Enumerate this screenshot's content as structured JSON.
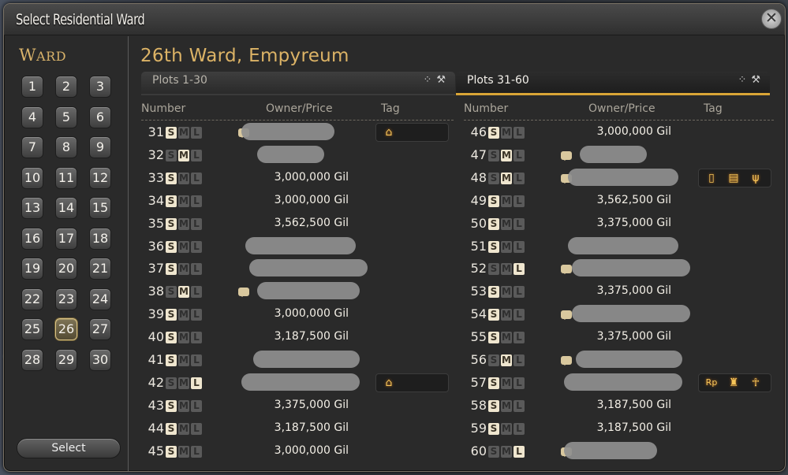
{
  "window": {
    "title": "Select Residential Ward",
    "close_symbol": "✕"
  },
  "ward_panel": {
    "label_first": "W",
    "label_rest": "ARD",
    "wards": [
      "1",
      "2",
      "3",
      "4",
      "5",
      "6",
      "7",
      "8",
      "9",
      "10",
      "11",
      "12",
      "13",
      "14",
      "15",
      "16",
      "17",
      "18",
      "19",
      "20",
      "21",
      "22",
      "23",
      "24",
      "25",
      "26",
      "27",
      "28",
      "29",
      "30"
    ],
    "selected": "26",
    "select_label": "Select"
  },
  "main": {
    "ward_title": "26th Ward, Empyreum",
    "tabs": [
      {
        "label": "Plots 1-30",
        "active": false,
        "icons": [
          "ownership-filter-icon",
          "auction-gavel-icon"
        ]
      },
      {
        "label": "Plots 31-60",
        "active": true,
        "icons": [
          "ownership-filter-icon",
          "auction-gavel-icon"
        ]
      }
    ],
    "columns": {
      "number": "Number",
      "owner_price": "Owner/Price",
      "tag": "Tag"
    },
    "left_rows": [
      {
        "number": "31",
        "size": "S",
        "price": "",
        "chat": true,
        "redacted": true,
        "tags": [
          "house-tag-icon"
        ]
      },
      {
        "number": "32",
        "size": "M",
        "price": "",
        "chat": false,
        "redacted": true,
        "tags": []
      },
      {
        "number": "33",
        "size": "S",
        "price": "3,000,000 Gil",
        "chat": false,
        "redacted": false,
        "tags": []
      },
      {
        "number": "34",
        "size": "S",
        "price": "3,000,000 Gil",
        "chat": false,
        "redacted": false,
        "tags": []
      },
      {
        "number": "35",
        "size": "S",
        "price": "3,562,500 Gil",
        "chat": false,
        "redacted": false,
        "tags": []
      },
      {
        "number": "36",
        "size": "S",
        "price": "",
        "chat": false,
        "redacted": true,
        "tags": []
      },
      {
        "number": "37",
        "size": "S",
        "price": "",
        "chat": false,
        "redacted": true,
        "tags": []
      },
      {
        "number": "38",
        "size": "M",
        "price": "",
        "chat": true,
        "redacted": true,
        "tags": []
      },
      {
        "number": "39",
        "size": "S",
        "price": "3,000,000 Gil",
        "chat": false,
        "redacted": false,
        "tags": []
      },
      {
        "number": "40",
        "size": "S",
        "price": "3,187,500 Gil",
        "chat": false,
        "redacted": false,
        "tags": []
      },
      {
        "number": "41",
        "size": "S",
        "price": "",
        "chat": false,
        "redacted": true,
        "tags": []
      },
      {
        "number": "42",
        "size": "L",
        "price": "",
        "chat": false,
        "redacted": true,
        "tags": [
          "house-tag-icon"
        ]
      },
      {
        "number": "43",
        "size": "S",
        "price": "3,375,000 Gil",
        "chat": false,
        "redacted": false,
        "tags": []
      },
      {
        "number": "44",
        "size": "S",
        "price": "3,187,500 Gil",
        "chat": false,
        "redacted": false,
        "tags": []
      },
      {
        "number": "45",
        "size": "S",
        "price": "3,000,000 Gil",
        "chat": false,
        "redacted": false,
        "tags": []
      }
    ],
    "right_rows": [
      {
        "number": "46",
        "size": "S",
        "price": "3,000,000 Gil",
        "chat": false,
        "redacted": false,
        "tags": []
      },
      {
        "number": "47",
        "size": "M",
        "price": "",
        "chat": true,
        "redacted": true,
        "tags": []
      },
      {
        "number": "48",
        "size": "M",
        "price": "",
        "chat": true,
        "redacted": true,
        "tags": [
          "door-tag-icon",
          "book-tag-icon",
          "dining-tag-icon"
        ]
      },
      {
        "number": "49",
        "size": "S",
        "price": "3,562,500 Gil",
        "chat": false,
        "redacted": false,
        "tags": []
      },
      {
        "number": "50",
        "size": "S",
        "price": "3,375,000 Gil",
        "chat": false,
        "redacted": false,
        "tags": []
      },
      {
        "number": "51",
        "size": "S",
        "price": "",
        "chat": false,
        "redacted": true,
        "tags": []
      },
      {
        "number": "52",
        "size": "L",
        "price": "",
        "chat": true,
        "redacted": true,
        "tags": []
      },
      {
        "number": "53",
        "size": "S",
        "price": "3,375,000 Gil",
        "chat": false,
        "redacted": false,
        "tags": []
      },
      {
        "number": "54",
        "size": "S",
        "price": "",
        "chat": true,
        "redacted": true,
        "tags": []
      },
      {
        "number": "55",
        "size": "S",
        "price": "3,375,000 Gil",
        "chat": false,
        "redacted": false,
        "tags": []
      },
      {
        "number": "56",
        "size": "M",
        "price": "",
        "chat": true,
        "redacted": true,
        "tags": []
      },
      {
        "number": "57",
        "size": "S",
        "price": "",
        "chat": false,
        "redacted": true,
        "tags": [
          "rp-tag-icon",
          "bar-tag-icon",
          "dance-tag-icon"
        ]
      },
      {
        "number": "58",
        "size": "S",
        "price": "3,187,500 Gil",
        "chat": false,
        "redacted": false,
        "tags": []
      },
      {
        "number": "59",
        "size": "S",
        "price": "3,187,500 Gil",
        "chat": false,
        "redacted": false,
        "tags": []
      },
      {
        "number": "60",
        "size": "L",
        "price": "",
        "chat": true,
        "redacted": true,
        "tags": []
      }
    ],
    "tag_glyphs": {
      "house-tag-icon": "⌂",
      "door-tag-icon": "▯",
      "book-tag-icon": "▤",
      "dining-tag-icon": "ψ",
      "rp-tag-icon": "Rp",
      "bar-tag-icon": "♜",
      "dance-tag-icon": "☥"
    }
  }
}
